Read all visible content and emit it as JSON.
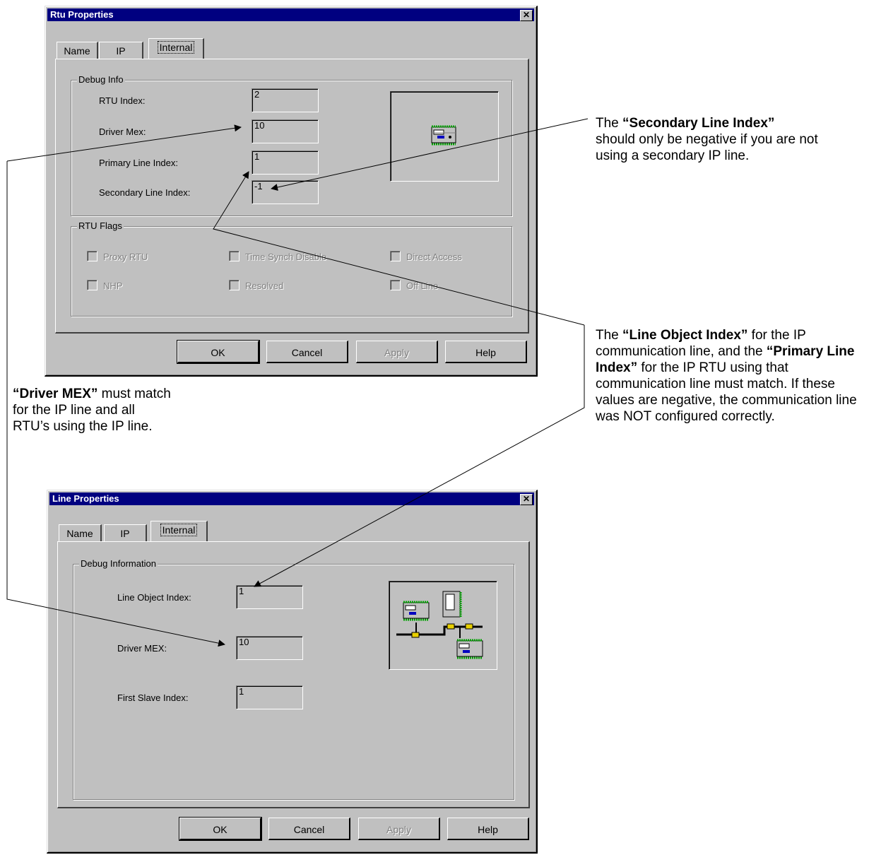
{
  "rtu_dialog": {
    "title": "Rtu Properties",
    "close": "✕",
    "tabs": [
      "Name",
      "IP",
      "Internal"
    ],
    "debug_group": "Debug Info",
    "fields": [
      {
        "label": "RTU Index:",
        "value": "2"
      },
      {
        "label": "Driver Mex:",
        "value": "10"
      },
      {
        "label": "Primary Line Index:",
        "value": "1"
      },
      {
        "label": "Secondary Line Index:",
        "value": "-1"
      }
    ],
    "flags_group": "RTU Flags",
    "flags": [
      "Proxy RTU",
      "Time Synch Disable",
      "Direct Access",
      "NHP",
      "Resolved",
      "Off Line"
    ],
    "buttons": [
      "OK",
      "Cancel",
      "Apply",
      "Help"
    ]
  },
  "line_dialog": {
    "title": "Line Properties",
    "close": "✕",
    "tabs": [
      "Name",
      "IP",
      "Internal"
    ],
    "debug_group": "Debug Information",
    "fields": [
      {
        "label": "Line Object Index:",
        "value": "1"
      },
      {
        "label": "Driver MEX:",
        "value": "10"
      },
      {
        "label": "First Slave Index:",
        "value": "1"
      }
    ],
    "buttons": [
      "OK",
      "Cancel",
      "Apply",
      "Help"
    ]
  },
  "annotations": {
    "secondary": {
      "pre": "The ",
      "bold": "“Secondary Line Index”",
      "rest": "should only be negative if you are not using a secondary IP line."
    },
    "line_object": {
      "pre": "The ",
      "bold1": "“Line Object Index”",
      "mid1": " for the IP communication line, and the ",
      "bold2": "“Primary Line Index”",
      "rest": " for the IP RTU using that communication line must match. If these values are negative, the communication line was NOT configured correctly."
    },
    "driver_mex": {
      "bold": "“Driver MEX”",
      "rest": " must match for the IP line and all RTU’s using the IP line."
    }
  }
}
